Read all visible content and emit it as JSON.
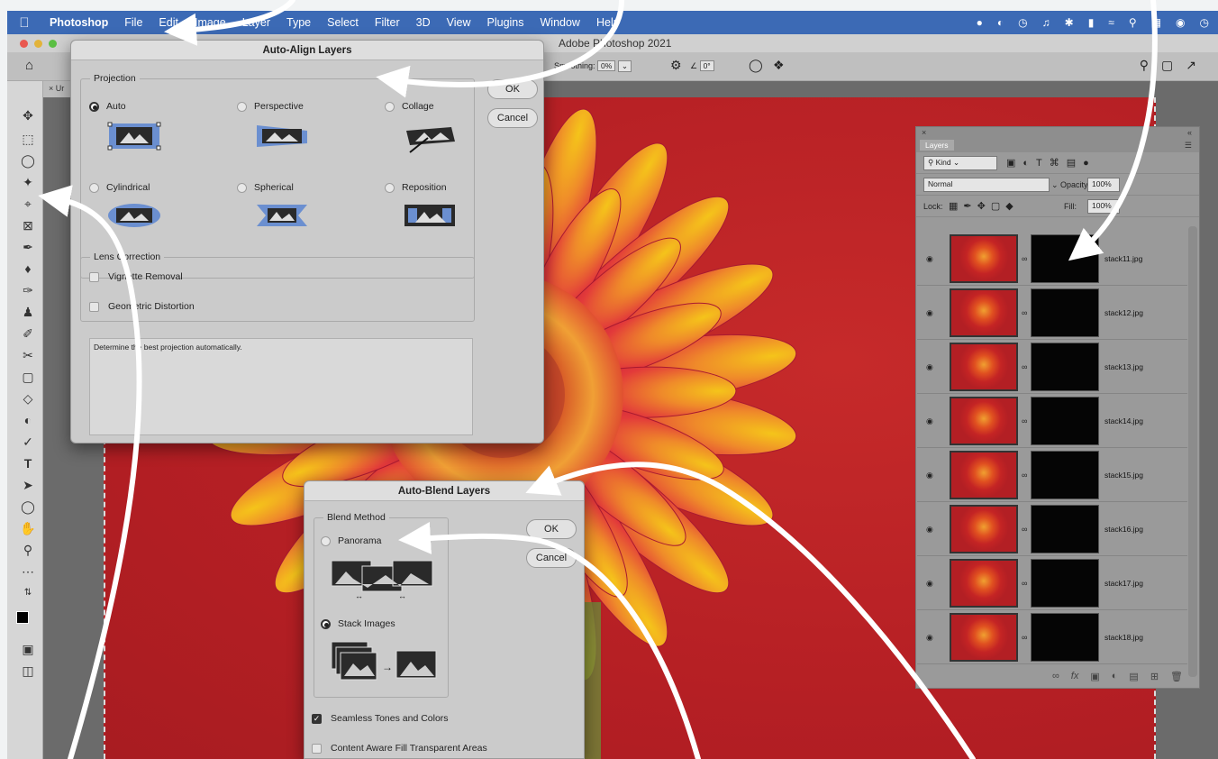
{
  "menubar": {
    "items": [
      "Photoshop",
      "File",
      "Edit",
      "Image",
      "Layer",
      "Type",
      "Select",
      "Filter",
      "3D",
      "View",
      "Plugins",
      "Window",
      "Help"
    ]
  },
  "window": {
    "title": "Adobe Photoshop 2021",
    "doc_tab": "Ur"
  },
  "options": {
    "smoothing_label": "Smoothing:",
    "smoothing_value": "0%",
    "angle_value": "0°"
  },
  "auto_align": {
    "title": "Auto-Align Layers",
    "projection_label": "Projection",
    "projections": [
      {
        "label": "Auto",
        "selected": true
      },
      {
        "label": "Perspective",
        "selected": false
      },
      {
        "label": "Collage",
        "selected": false
      },
      {
        "label": "Cylindrical",
        "selected": false
      },
      {
        "label": "Spherical",
        "selected": false
      },
      {
        "label": "Reposition",
        "selected": false
      }
    ],
    "lens_label": "Lens Correction",
    "vignette_label": "Vignette Removal",
    "geometric_label": "Geometric Distortion",
    "description": "Determine the best projection automatically.",
    "ok": "OK",
    "cancel": "Cancel"
  },
  "auto_blend": {
    "title": "Auto-Blend Layers",
    "method_label": "Blend Method",
    "panorama": "Panorama",
    "stack": "Stack Images",
    "seamless": "Seamless Tones and Colors",
    "content_aware": "Content Aware Fill Transparent Areas",
    "ok": "OK",
    "cancel": "Cancel"
  },
  "layers": {
    "title": "Layers",
    "filter": "Kind",
    "blend_mode": "Normal",
    "opacity_label": "Opacity:",
    "opacity": "100%",
    "lock_label": "Lock:",
    "fill_label": "Fill:",
    "fill": "100%",
    "items": [
      "stack11.jpg",
      "stack12.jpg",
      "stack13.jpg",
      "stack14.jpg",
      "stack15.jpg",
      "stack16.jpg",
      "stack17.jpg",
      "stack18.jpg"
    ]
  },
  "colors": {
    "menubar": "#3c6ab5",
    "canvas_red": "#b51f24",
    "dialog_bg": "#cbcbcb"
  }
}
